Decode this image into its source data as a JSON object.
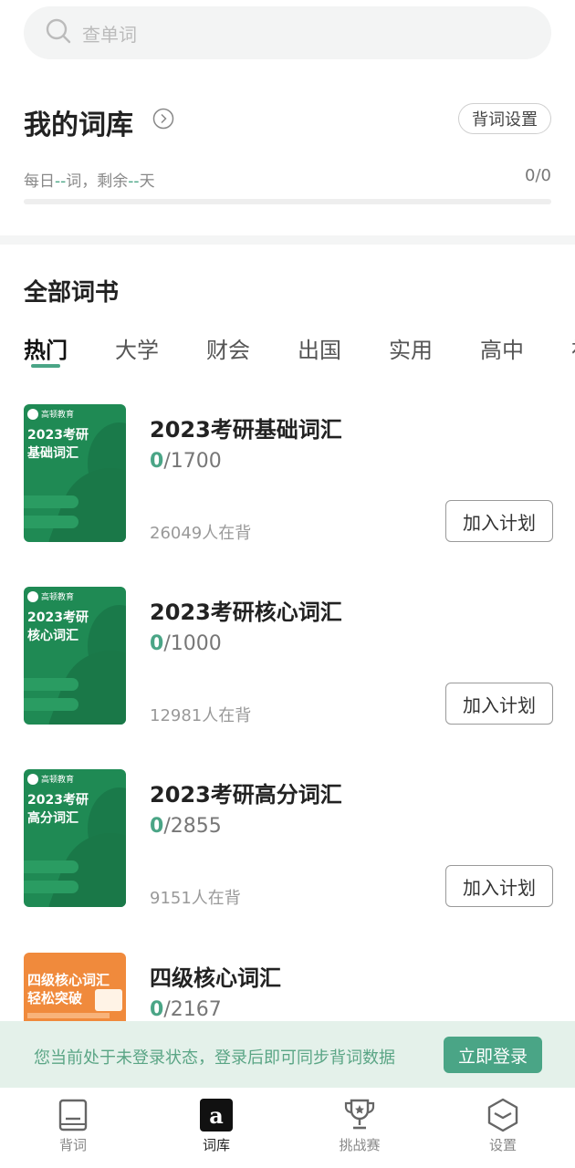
{
  "search": {
    "placeholder": "查单词"
  },
  "library": {
    "title": "我的词库",
    "settings_label": "背词设置",
    "daily_prefix": "每日",
    "daily_words": "--",
    "daily_mid": "词，剩余",
    "daily_days": "--",
    "daily_suffix": "天",
    "progress": "0/0",
    "progress_fraction": 0
  },
  "all_books": {
    "title": "全部词书",
    "tabs": [
      "热门",
      "大学",
      "财会",
      "出国",
      "实用",
      "高中",
      "初"
    ],
    "active_tab": "热门"
  },
  "books": [
    {
      "title": "2023考研基础词汇",
      "done": "0",
      "total": "/1700",
      "readers": "26049人在背",
      "add_label": "加入计划",
      "cover_brand": "高顿教育",
      "cover_title_1": "2023考研",
      "cover_title_2": "基础词汇",
      "cover_color": "#1f8a54"
    },
    {
      "title": "2023考研核心词汇",
      "done": "0",
      "total": "/1000",
      "readers": "12981人在背",
      "add_label": "加入计划",
      "cover_brand": "高顿教育",
      "cover_title_1": "2023考研",
      "cover_title_2": "核心词汇",
      "cover_color": "#1f8a54"
    },
    {
      "title": "2023考研高分词汇",
      "done": "0",
      "total": "/2855",
      "readers": "9151人在背",
      "add_label": "加入计划",
      "cover_brand": "高顿教育",
      "cover_title_1": "2023考研",
      "cover_title_2": "高分词汇",
      "cover_color": "#1f8a54"
    },
    {
      "title": "四级核心词汇",
      "done": "0",
      "total": "/2167",
      "cover_title_1": "四级核心词汇",
      "cover_title_2": "轻松突破",
      "cover_color": "#f08a3c"
    }
  ],
  "login_banner": {
    "message": "您当前处于未登录状态，登录后即可同步背词数据",
    "button": "立即登录"
  },
  "nav": [
    {
      "label": "背词",
      "icon": "book-icon"
    },
    {
      "label": "词库",
      "icon": "letter-a-icon",
      "active": true
    },
    {
      "label": "挑战赛",
      "icon": "trophy-icon"
    },
    {
      "label": "设置",
      "icon": "settings-hexagon-icon"
    }
  ],
  "colors": {
    "accent": "#4aa586",
    "banner_bg": "#e4f1ea"
  }
}
